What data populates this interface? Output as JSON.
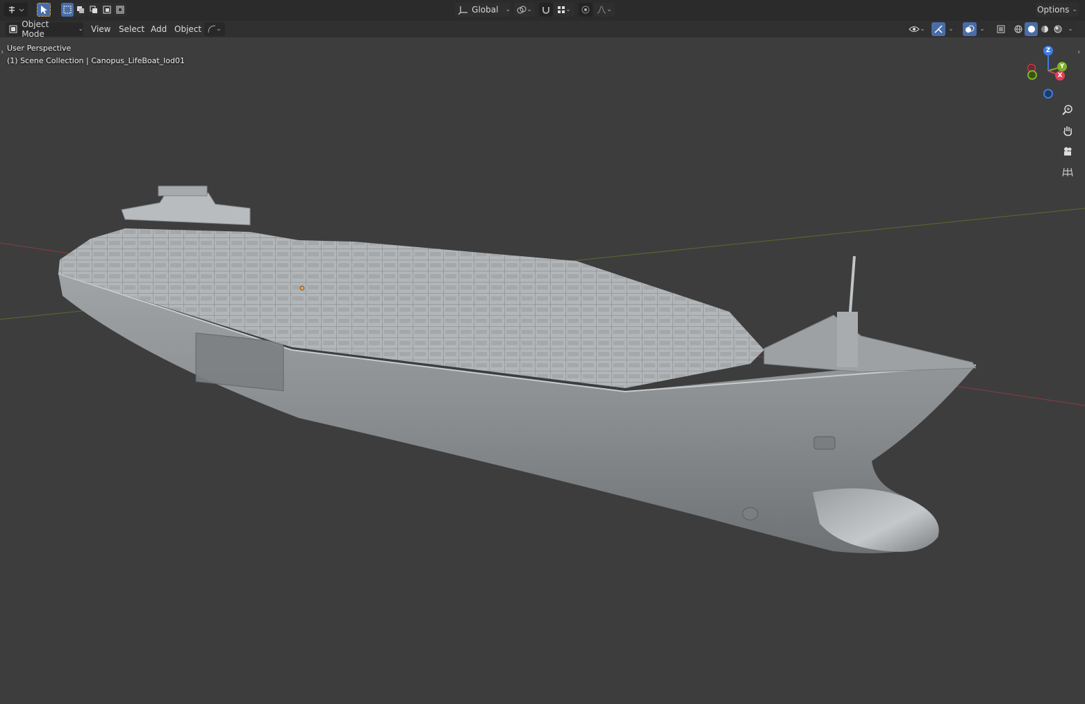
{
  "topbar": {
    "transform_orientation": "Global",
    "options_label": "Options"
  },
  "header": {
    "mode_label": "Object Mode",
    "menus": [
      "View",
      "Select",
      "Add",
      "Object"
    ]
  },
  "viewport": {
    "perspective_label": "User Perspective",
    "collection_label": "(1) Scene Collection | Canopus_LifeBoat_lod01",
    "gizmo": {
      "x_label": "X",
      "y_label": "Y",
      "z_label": "Z"
    },
    "nav_icons": [
      "zoom-icon",
      "hand-pan-icon",
      "camera-icon",
      "grid-ortho-icon"
    ]
  },
  "colors": {
    "viewport_bg": "#3d3d3d",
    "header_bg": "#303030",
    "accent": "#4a6da7",
    "axis_x": "#e43e54",
    "axis_y": "#7db228",
    "axis_z": "#3f7ce0",
    "hull": "#8d9294"
  }
}
